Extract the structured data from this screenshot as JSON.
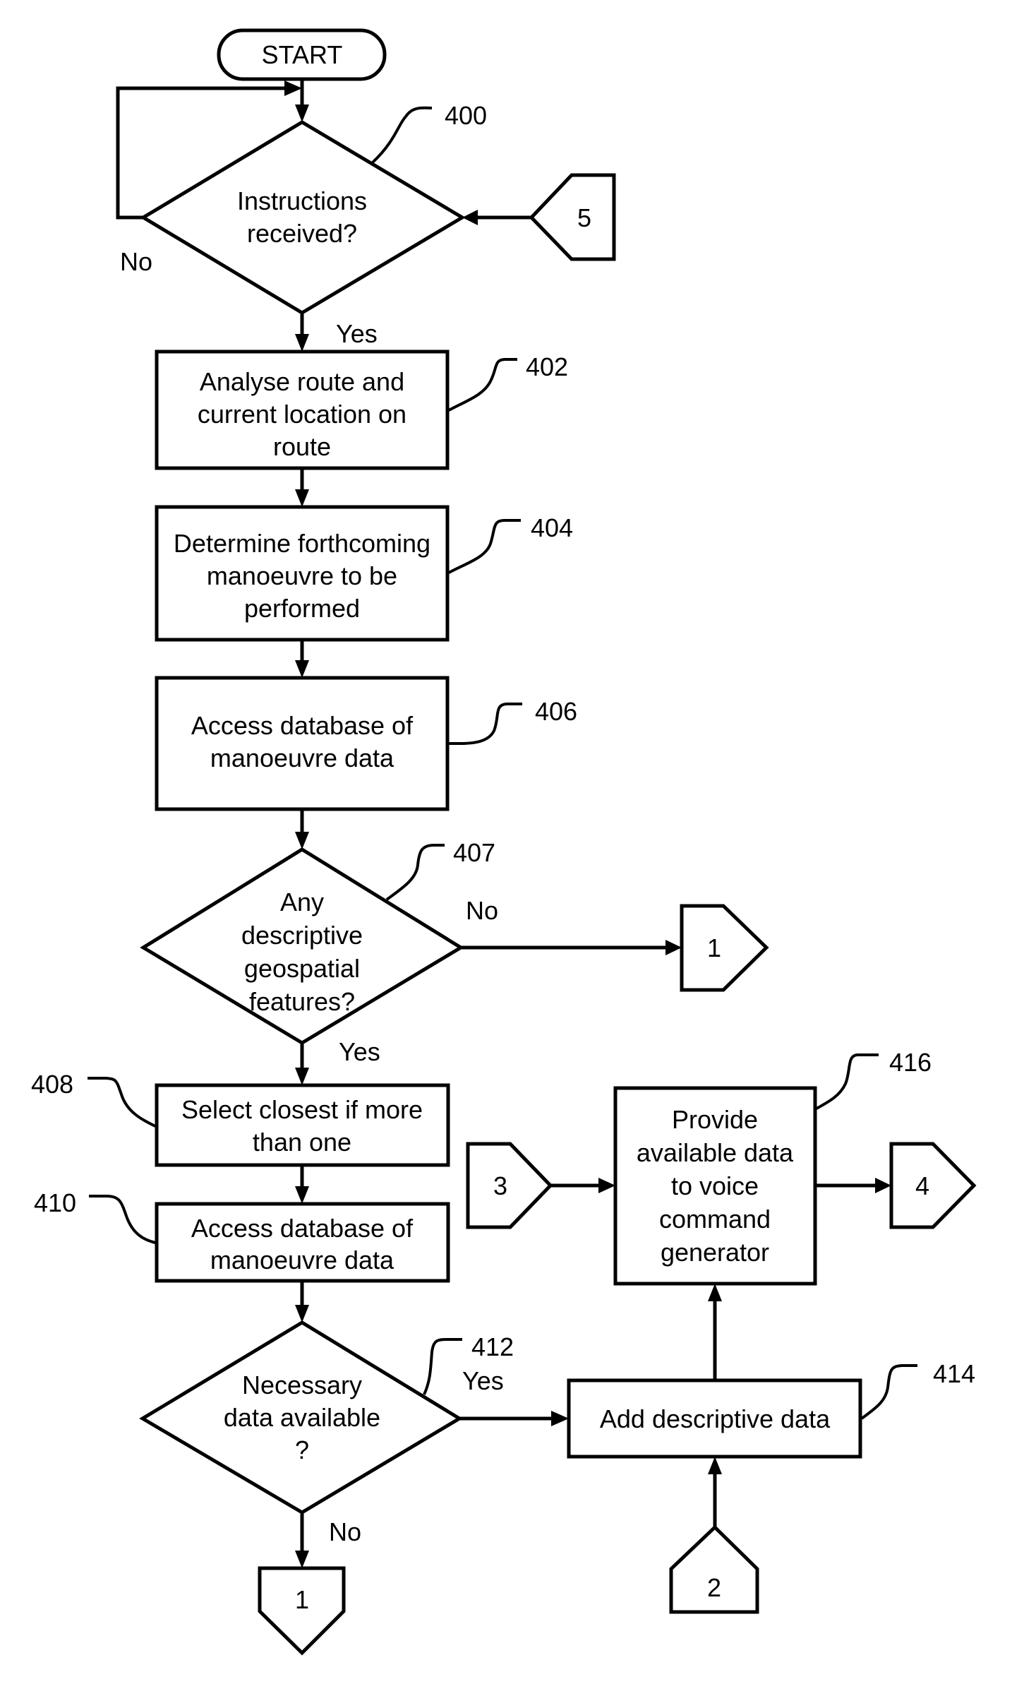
{
  "flowchart": {
    "start": {
      "label": "START"
    },
    "steps": [
      {
        "id": "400",
        "type": "decision",
        "lines": [
          "Instructions",
          "received?"
        ],
        "no_label": "No",
        "yes_label": "Yes"
      },
      {
        "id": "402",
        "type": "process",
        "lines": [
          "Analyse route and",
          "current location on",
          "route"
        ]
      },
      {
        "id": "404",
        "type": "process",
        "lines": [
          "Determine forthcoming",
          "manoeuvre to be",
          "performed"
        ]
      },
      {
        "id": "406",
        "type": "process",
        "lines": [
          "Access database of",
          "manoeuvre data"
        ]
      },
      {
        "id": "407",
        "type": "decision",
        "lines": [
          "Any",
          "descriptive",
          "geospatial",
          "features?"
        ],
        "no_label": "No",
        "yes_label": "Yes"
      },
      {
        "id": "408",
        "type": "process",
        "lines": [
          "Select closest if more",
          "than one"
        ]
      },
      {
        "id": "410",
        "type": "process",
        "lines": [
          "Access database of",
          "manoeuvre data"
        ]
      },
      {
        "id": "412",
        "type": "decision",
        "lines": [
          "Necessary",
          "data available",
          "?"
        ],
        "yes_label": "Yes",
        "no_label": "No"
      },
      {
        "id": "414",
        "type": "process",
        "lines": [
          "Add descriptive data"
        ]
      },
      {
        "id": "416",
        "type": "process",
        "lines": [
          "Provide",
          "available data",
          "to voice",
          "command",
          "generator"
        ]
      }
    ],
    "connectors": {
      "c5_in": "5",
      "c1_out_right": "1",
      "c3_in": "3",
      "c4_out": "4",
      "c1_out_bottom": "1",
      "c2_in": "2"
    }
  }
}
